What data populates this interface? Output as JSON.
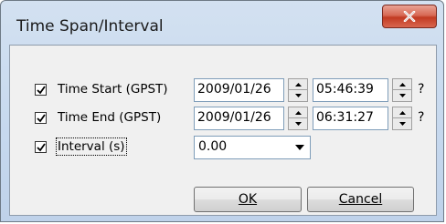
{
  "window": {
    "title": "Time Span/Interval",
    "close_icon": "close-icon",
    "close_color": "#c23b22"
  },
  "rows": [
    {
      "checked": true,
      "label": "Time Start (GPST)",
      "date": "2009/01/26",
      "time": "05:46:39",
      "help": "?"
    },
    {
      "checked": true,
      "label": "Time End (GPST)",
      "date": "2009/01/26",
      "time": "06:31:27",
      "help": "?"
    }
  ],
  "interval": {
    "checked": true,
    "label": "Interval (s)",
    "value": "0.00"
  },
  "buttons": {
    "ok": "OK",
    "cancel": "Cancel"
  }
}
